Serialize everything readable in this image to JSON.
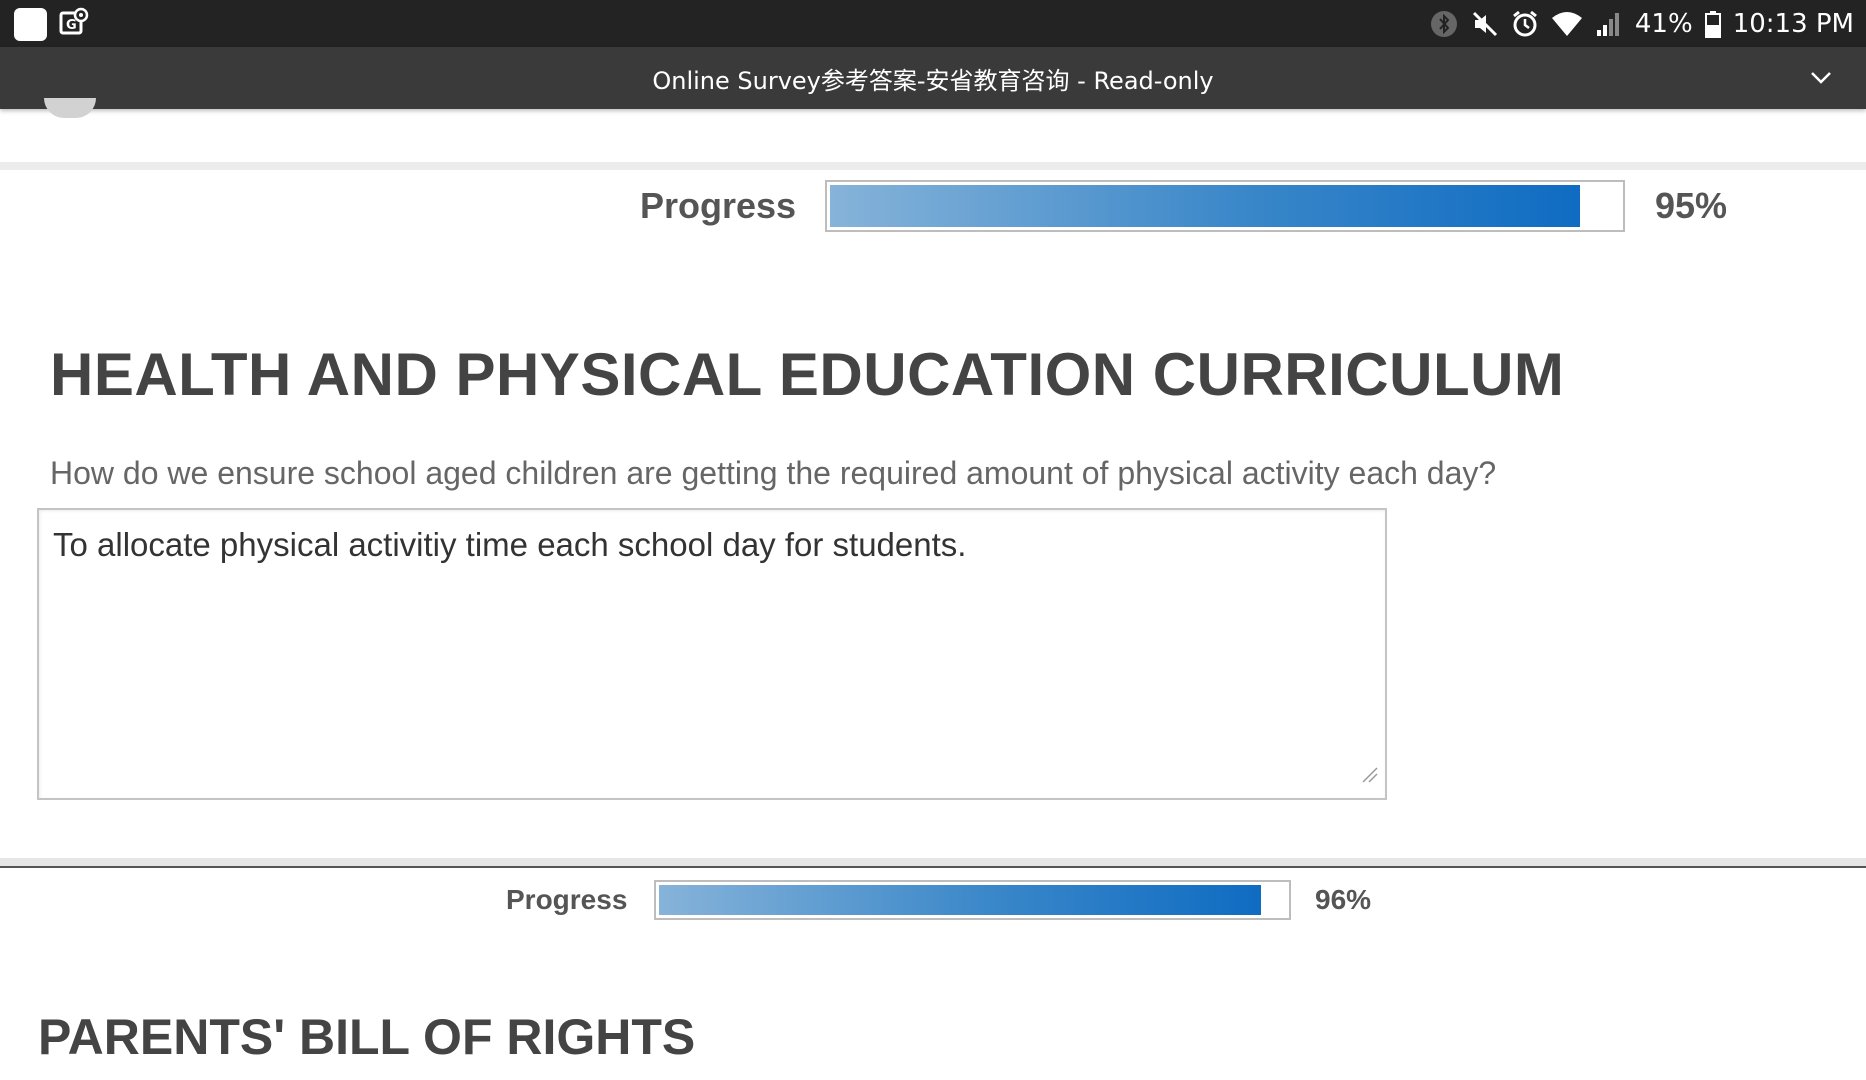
{
  "status_bar": {
    "battery_percent": "41%",
    "time": "10:13 PM",
    "left_icons": [
      "app-square-icon",
      "maps-location-icon"
    ],
    "right_icons": [
      "bluetooth-icon",
      "mute-icon",
      "alarm-icon",
      "wifi-icon",
      "signal-icon",
      "battery-icon"
    ]
  },
  "title_bar": {
    "title": "Online Survey参考答案-安省教育咨询 - Read-only",
    "menu_icon": "chevron-down-icon"
  },
  "progress_top": {
    "label": "Progress",
    "value_text": "95%",
    "fraction": 0.95
  },
  "section_1": {
    "heading": "HEALTH AND PHYSICAL EDUCATION CURRICULUM",
    "question": "How do we ensure school aged children are getting the required amount of physical activity each day?",
    "answer": "To allocate physical activitiy time each school day for students."
  },
  "progress_bottom": {
    "label": "Progress",
    "value_text": "96%",
    "fraction": 0.96
  },
  "section_2": {
    "heading": "PARENTS' BILL OF RIGHTS"
  },
  "colors": {
    "status_bar_bg": "#232323",
    "title_bar_bg": "#3a3a3a",
    "progress_fill": "#0f6cc2",
    "heading_text": "#444444"
  }
}
